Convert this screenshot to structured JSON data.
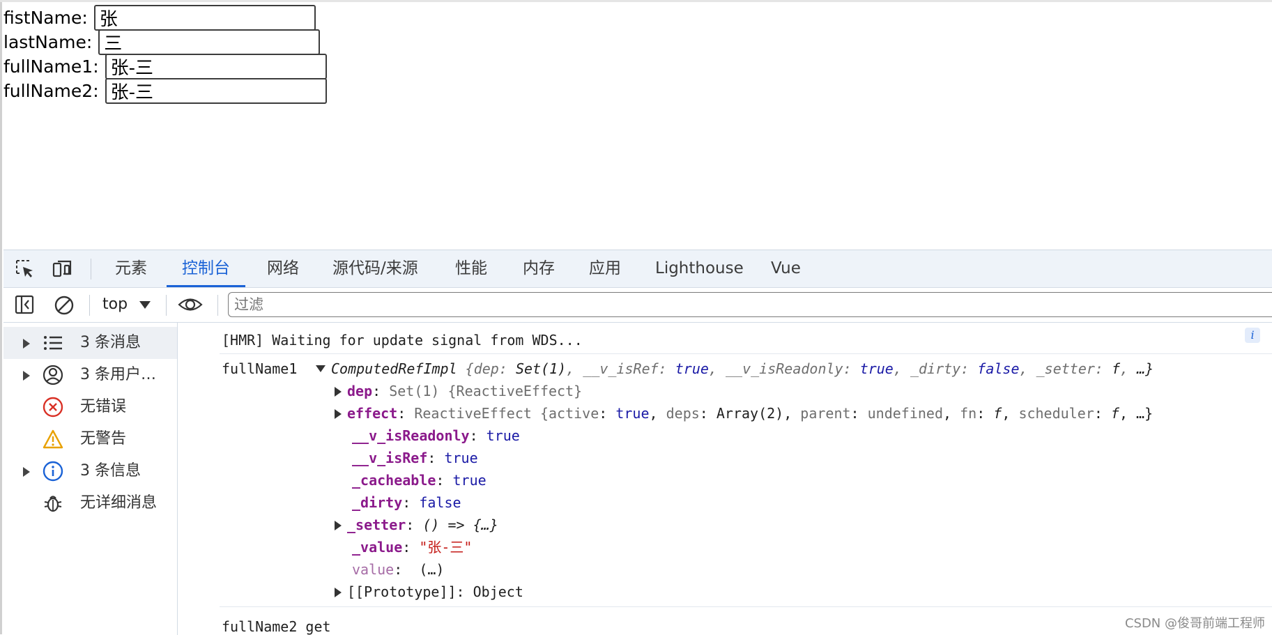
{
  "form": {
    "fields": [
      {
        "label": "fistName:",
        "value": "张"
      },
      {
        "label": "lastName:",
        "value": "三"
      },
      {
        "label": "fullName1:",
        "value": "张-三"
      },
      {
        "label": "fullName2:",
        "value": "张-三"
      }
    ]
  },
  "devtools": {
    "icons": {
      "inspect": "inspect-element-icon",
      "device": "device-toolbar-icon"
    },
    "tabs": [
      "元素",
      "控制台",
      "网络",
      "源代码/来源",
      "性能",
      "内存",
      "应用",
      "Lighthouse",
      "Vue"
    ],
    "active_tab": "控制台",
    "accent_color": "#1a62d6",
    "toolbar": {
      "context": "top",
      "filter_placeholder": "过滤"
    },
    "sidebar": [
      {
        "label": "3 条消息",
        "icon": "list-icon",
        "expandable": true
      },
      {
        "label": "3 条用户…",
        "icon": "user-icon",
        "expandable": true
      },
      {
        "label": "无错误",
        "icon": "error-icon",
        "expandable": false
      },
      {
        "label": "无警告",
        "icon": "warning-icon",
        "expandable": false
      },
      {
        "label": "3 条信息",
        "icon": "info-icon",
        "expandable": true
      },
      {
        "label": "无详细消息",
        "icon": "bug-icon",
        "expandable": false
      }
    ],
    "console": {
      "hmr": "[HMR] Waiting for update signal from WDS...",
      "log_label": "fullName1",
      "obj_name": "ComputedRefImpl",
      "obj_preview_parts": {
        "open": "{",
        "dep_k": "dep",
        "dep_v": "Set(1)",
        "isref_k": "__v_isRef",
        "isref_v": "true",
        "isro_k": "__v_isReadonly",
        "isro_v": "true",
        "dirty_k": "_dirty",
        "dirty_v": "false",
        "setter_k": "_setter",
        "setter_v": "f",
        "close": "…}"
      },
      "props": {
        "dep": {
          "key": "dep",
          "value": "Set(1) {ReactiveEffect}"
        },
        "effect": {
          "key": "effect",
          "v1": "ReactiveEffect {",
          "active_k": "active",
          "active_v": "true",
          "deps_k": "deps",
          "deps_v": "Array(2)",
          "parent_k": "parent",
          "parent_v": "undefined",
          "fn_k": "fn",
          "fn_v": "f",
          "sched_k": "scheduler",
          "sched_v": "f",
          "close": "…}"
        },
        "isReadonly": {
          "key": "__v_isReadonly",
          "value": "true"
        },
        "isRef": {
          "key": "__v_isRef",
          "value": "true"
        },
        "cacheable": {
          "key": "_cacheable",
          "value": "true"
        },
        "dirty": {
          "key": "_dirty",
          "value": "false"
        },
        "setter": {
          "key": "_setter",
          "value": "() => {…}"
        },
        "value_": {
          "key": "_value",
          "value": "\"张-三\""
        },
        "value": {
          "key": "value",
          "value": "(…)"
        },
        "proto": {
          "key": "[[Prototype]]",
          "value": "Object"
        }
      },
      "next_log": "fullName2 get"
    }
  },
  "watermark": "CSDN @俊哥前端工程师"
}
